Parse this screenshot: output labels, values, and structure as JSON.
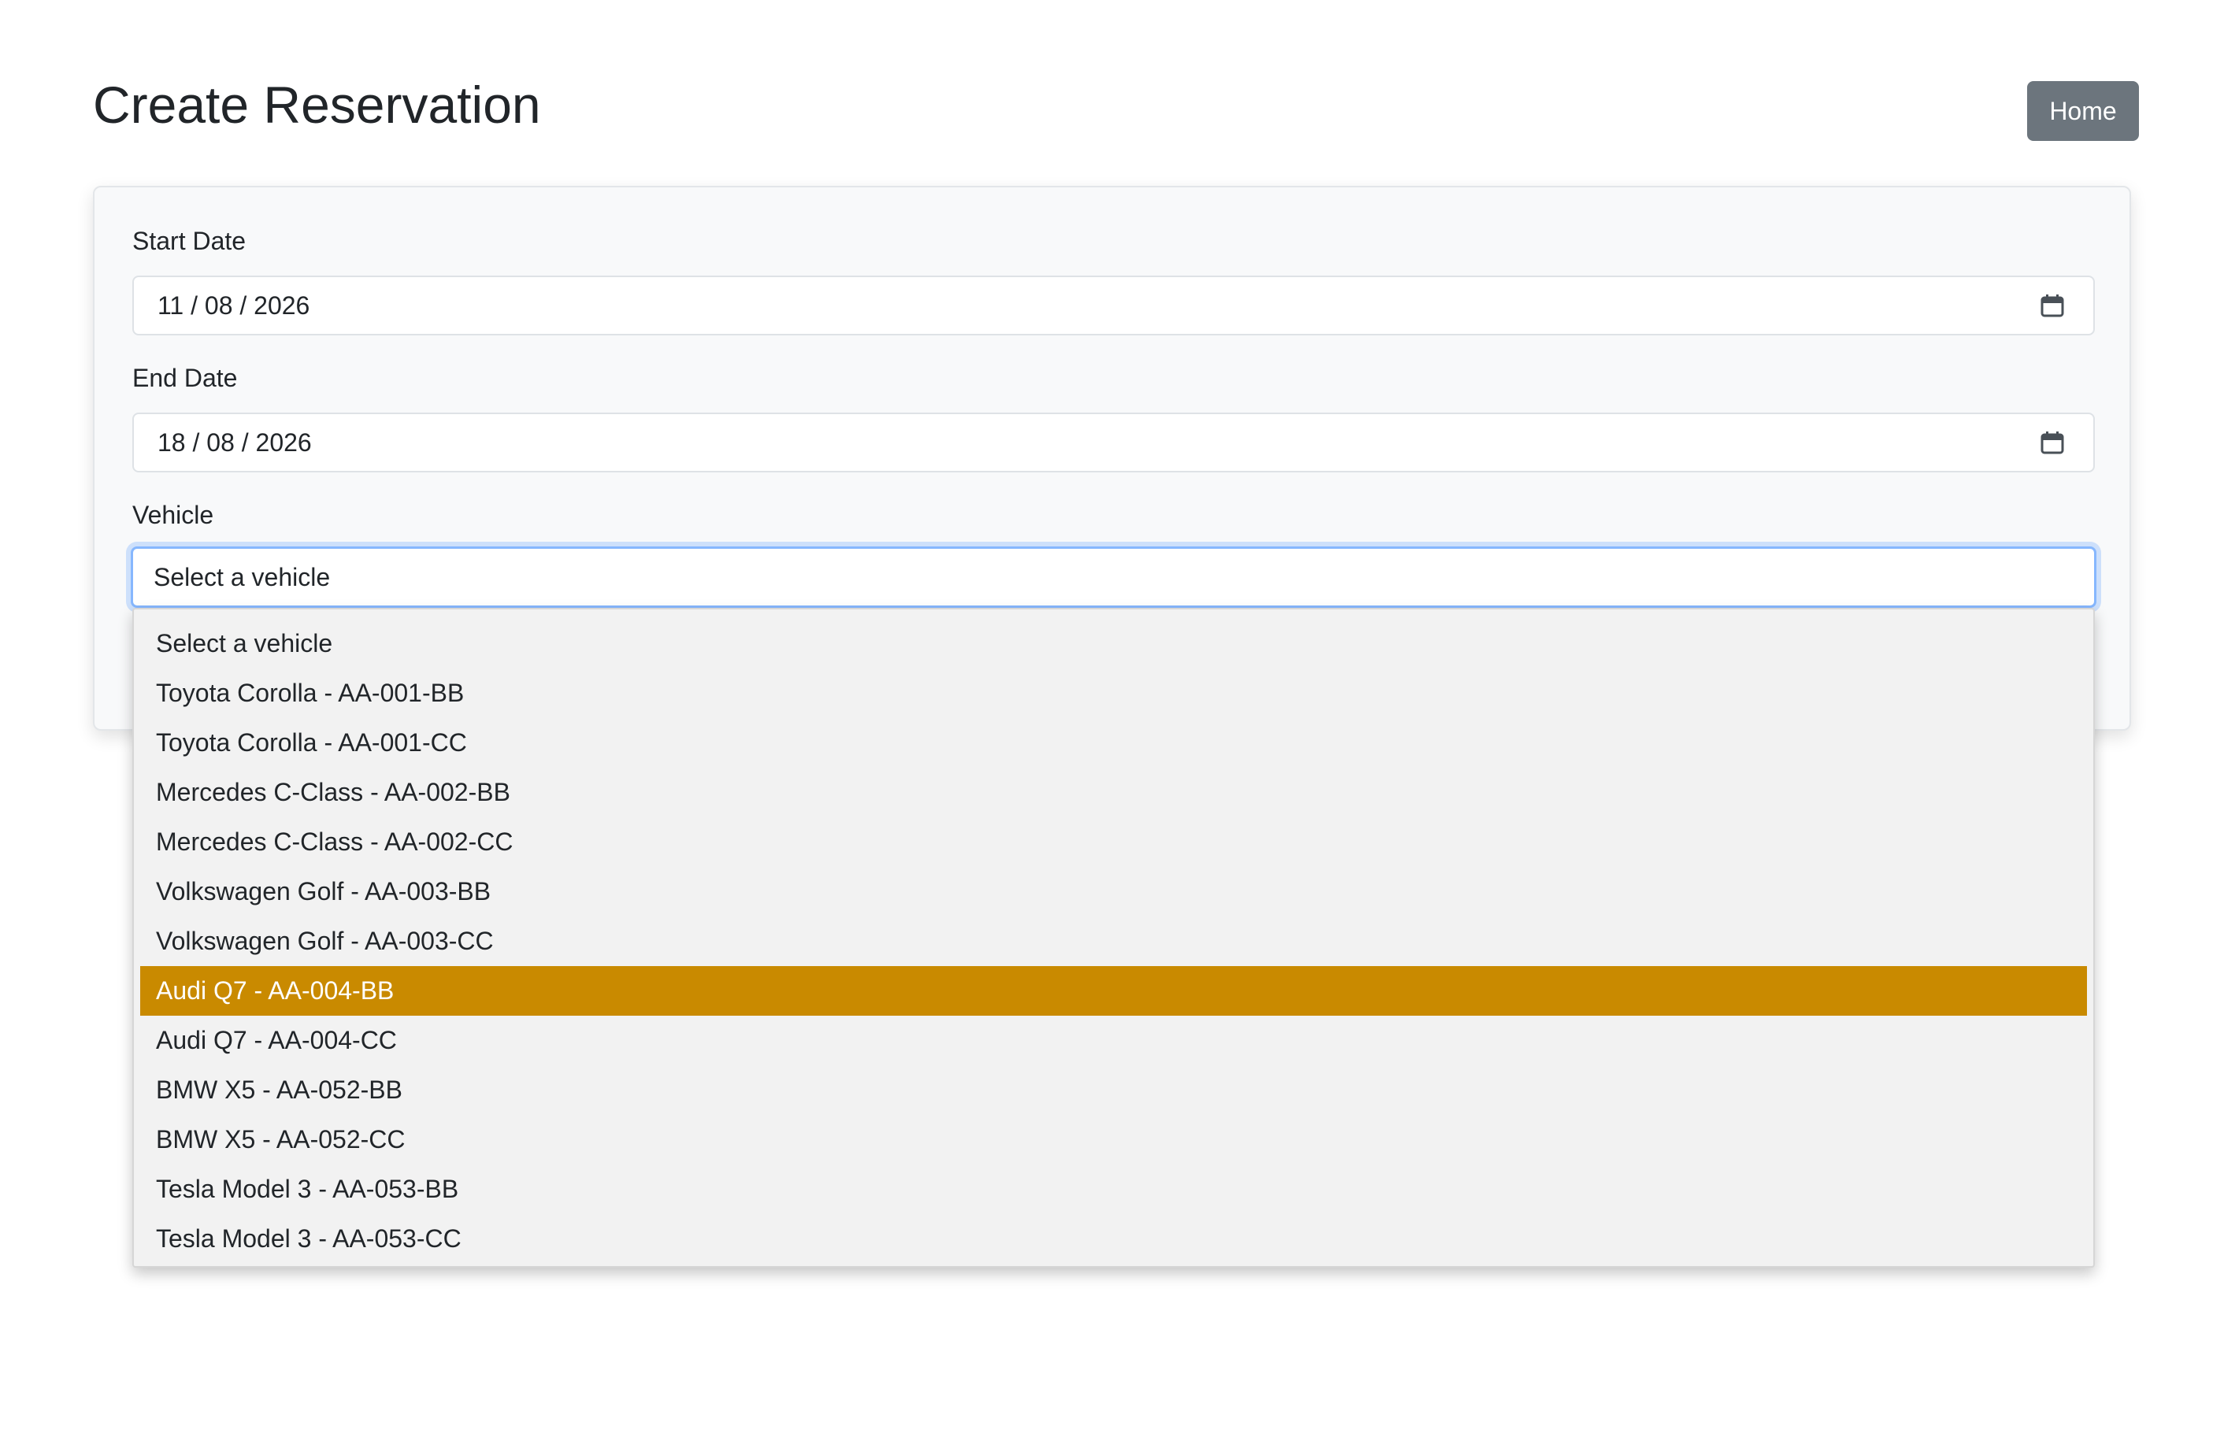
{
  "page": {
    "title": "Create Reservation",
    "home_label": "Home"
  },
  "form": {
    "start_date_label": "Start Date",
    "start_date_value": "11 / 08 / 2026",
    "end_date_label": "End Date",
    "end_date_value": "18 / 08 / 2026",
    "vehicle_label": "Vehicle",
    "vehicle_value": "Select a vehicle",
    "calendar_icon": "calendar-icon"
  },
  "dropdown": {
    "highlighted_index": 7,
    "options": [
      "Select a vehicle",
      "Toyota Corolla - AA-001-BB",
      "Toyota Corolla - AA-001-CC",
      "Mercedes C-Class - AA-002-BB",
      "Mercedes C-Class - AA-002-CC",
      "Volkswagen Golf - AA-003-BB",
      "Volkswagen Golf - AA-003-CC",
      "Audi Q7 - AA-004-BB",
      "Audi Q7 - AA-004-CC",
      "BMW X5 - AA-052-BB",
      "BMW X5 - AA-052-CC",
      "Tesla Model 3 - AA-053-BB",
      "Tesla Model 3 - AA-053-CC"
    ]
  },
  "colors": {
    "home_button": "#6c757d",
    "highlight": "#c98a00",
    "focus_border": "#86b7fe",
    "card_background": "#f8f9fa",
    "dropdown_background": "#f2f2f2"
  }
}
